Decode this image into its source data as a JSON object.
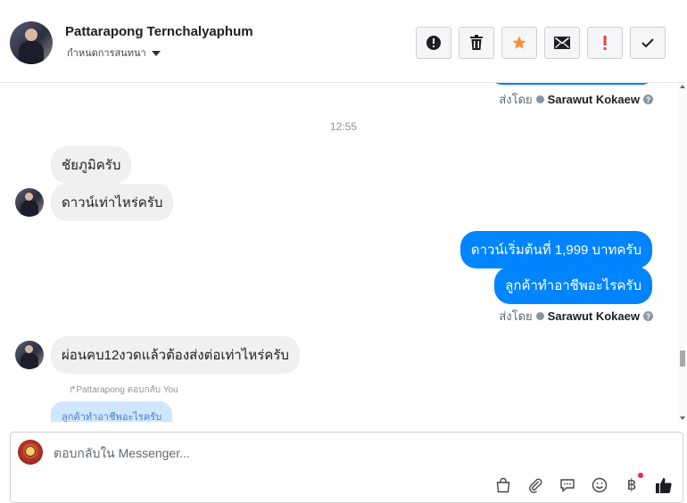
{
  "header": {
    "contact_name": "Pattarapong Ternchalyaphum",
    "assign_label": "กำหนดการสนทนา",
    "actions": [
      {
        "name": "spam-button",
        "icon": "alert-circle-icon"
      },
      {
        "name": "delete-button",
        "icon": "trash-icon"
      },
      {
        "name": "star-button",
        "icon": "star-icon",
        "color": "#f7923b"
      },
      {
        "name": "mark-unread-button",
        "icon": "envelope-icon"
      },
      {
        "name": "follow-up-button",
        "icon": "exclamation-icon",
        "color": "#fa3e3e"
      },
      {
        "name": "done-button",
        "icon": "checkmark-icon"
      }
    ]
  },
  "chat": {
    "sent_by_prefix": "ส่งโดย",
    "sent_by_name": "Sarawut Kokaew",
    "timestamp": "12:55",
    "in_msg_1": "ชัยภูมิครับ",
    "in_msg_2": "ดาวน์เท่าไหร่ครับ",
    "out_msg_1": "ดาวน์เริ่มต้นที่ 1,999 บาทครับ",
    "out_msg_2": "ลูกค้าทำอาชีพอะไรครับ",
    "in_msg_3": "ผ่อนคบ12งวดแล้วต้องส่งต่อเท่าไหร่ครับ",
    "reply_note": "Pattarapong ตอบกลับ You",
    "reply_quote": "ลูกค้าทำอาชีพอะไรครับ"
  },
  "composer": {
    "placeholder": "ตอบกลับใน Messenger..."
  },
  "colors": {
    "outgoing_bubble": "#0084ff",
    "incoming_bubble": "#f1f0f0",
    "star": "#f7923b",
    "follow_up": "#fa3e3e"
  }
}
